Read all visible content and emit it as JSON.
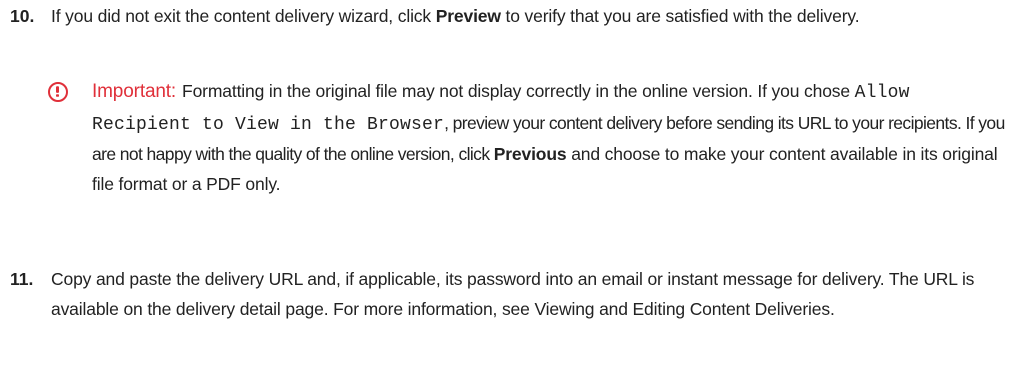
{
  "steps": [
    {
      "number": "10.",
      "parts": [
        "If you did not exit the content delivery wizard, click ",
        "Preview",
        " to verify that you are satisfied with the delivery."
      ]
    },
    {
      "number": "11.",
      "text": "Copy and paste the delivery URL and, if applicable, its password into an email or instant message for delivery. The URL is available on the delivery detail page. For more information, see Viewing and Editing Content Deliveries."
    }
  ],
  "callout": {
    "icon": "exclamation-circle-icon",
    "label": "Important:",
    "label_color": "#e0303a",
    "part1": "Formatting in the original file may not display correctly in the online version. If you chose ",
    "code": "Allow Recipient to View in the Browser",
    "part2": ", preview your content delivery before sending its URL to your recipients. If you are not happy with the quality of the online version, click ",
    "bold": "Previous",
    "part3": " and choose to make your content available in its original file format or a PDF only."
  }
}
